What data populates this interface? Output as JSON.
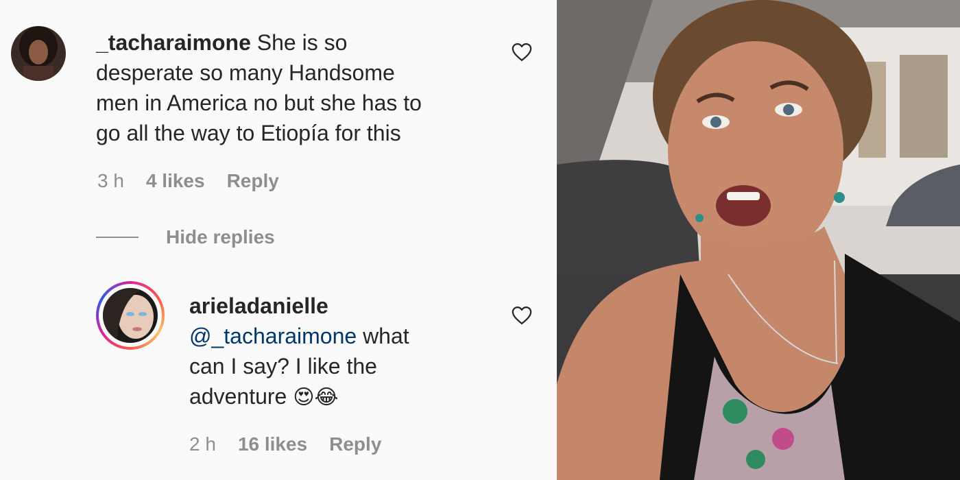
{
  "comment": {
    "username": "_tacharaimone",
    "text_lines": [
      "She is so",
      "desperate so many Handsome",
      "men in America no but she has to",
      "go all the way to Etiopía for this"
    ],
    "time": "3 h",
    "likes": "4 likes",
    "reply_label": "Reply"
  },
  "hide_replies_label": "Hide replies",
  "reply": {
    "username": "arieladanielle",
    "mention": "@_tacharaimone",
    "text_line1_rest": " what",
    "text_line2": "can I say? I like the",
    "text_line3": "adventure",
    "emojis": "😍😂",
    "time": "2 h",
    "likes": "16 likes",
    "reply_label": "Reply"
  },
  "icons": {
    "like": "heart-outline-icon",
    "avatar_ring": "story-ring"
  },
  "colors": {
    "text": "#262626",
    "muted": "#8e8e8e",
    "mention": "#00376b",
    "background": "#fafafa"
  }
}
